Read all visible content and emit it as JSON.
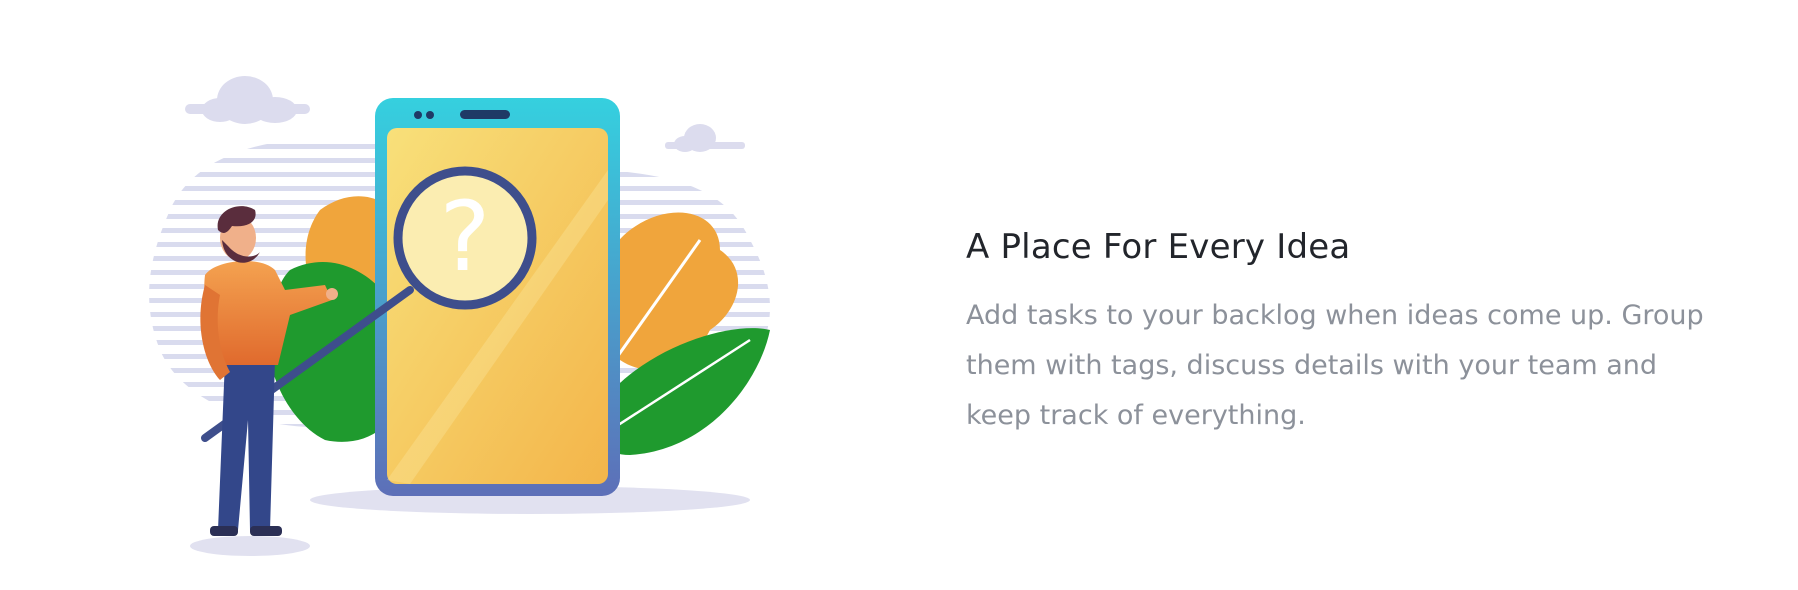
{
  "feature": {
    "title": "A Place For Every Idea",
    "description": "Add tasks to your backlog when ideas come up. Group them with tags, discuss details with your team and keep track of everything.",
    "illustration": {
      "phone_question_mark": "?",
      "icons": [
        "cloud-icon",
        "phone-illustration",
        "magnifier-icon",
        "person-illustration",
        "leaf-icon"
      ]
    }
  },
  "colors": {
    "title": "#22252b",
    "description": "#8c919a",
    "phone_frame": "#2cc3d4",
    "phone_screen": "#f6c650",
    "leaf_green": "#1f9a2e",
    "leaf_orange": "#f0a53c",
    "stripes": "#d9dbee",
    "cloud": "#dcdcee"
  }
}
